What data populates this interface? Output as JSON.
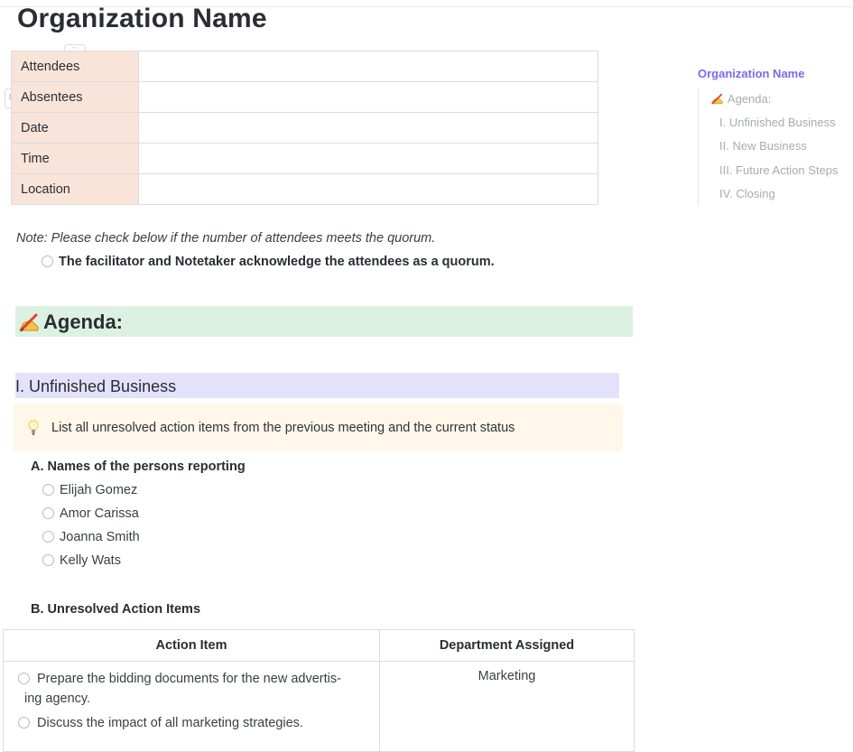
{
  "document": {
    "title": "Organization Name"
  },
  "info_table": {
    "rows": [
      {
        "label": "Attendees",
        "value": ""
      },
      {
        "label": "Absentees",
        "value": ""
      },
      {
        "label": "Date",
        "value": ""
      },
      {
        "label": "Time",
        "value": ""
      },
      {
        "label": "Location",
        "value": ""
      }
    ],
    "column_handle_icon": "drag-handle-icon",
    "row_handle_icon": "drag-handle-icon"
  },
  "quorum": {
    "note": "Note: Please check below if the number of attendees meets the quorum.",
    "checkbox_label": "The facilitator and Notetaker acknowledge the attendees as a quorum.",
    "checked": false
  },
  "agenda": {
    "icon": "writing-hand-icon",
    "heading": "Agenda:",
    "background": "#dcf1e2"
  },
  "unfinished_business": {
    "heading": "I. Unfinished Business",
    "background": "#e4e2fa",
    "callout": {
      "icon": "lightbulb-icon",
      "text": "List all unresolved action items from the previous meeting and the current status",
      "background": "#fef7ea"
    },
    "section_a": {
      "heading": "A. Names of the persons reporting",
      "people": [
        {
          "name": "Elijah Gomez",
          "checked": false
        },
        {
          "name": "Amor Carissa",
          "checked": false
        },
        {
          "name": "Joanna Smith",
          "checked": false
        },
        {
          "name": "Kelly Wats",
          "checked": false
        }
      ]
    },
    "section_b": {
      "heading": "B. Unresolved Action Items",
      "table": {
        "headers": [
          "Action Item",
          "Department Assigned"
        ],
        "rows": [
          {
            "items": [
              {
                "text": "Prepare the bidding documents for the new advertis-ing agency.",
                "line1": "Prepare the bidding documents for the new advertis-",
                "line2": "ing agency.",
                "checked": false
              },
              {
                "text": "Discuss the impact of all marketing strategies.",
                "checked": false
              }
            ],
            "department": "Marketing"
          }
        ]
      }
    }
  },
  "toc": {
    "title": "Organization Name",
    "accent": "#7b68ee",
    "items": [
      {
        "label": "Agenda:",
        "icon": "writing-hand-icon"
      },
      {
        "label": "I. Unfinished Business"
      },
      {
        "label": "II. New Business"
      },
      {
        "label": "III. Future Action Steps"
      },
      {
        "label": "IV. Closing"
      }
    ]
  }
}
